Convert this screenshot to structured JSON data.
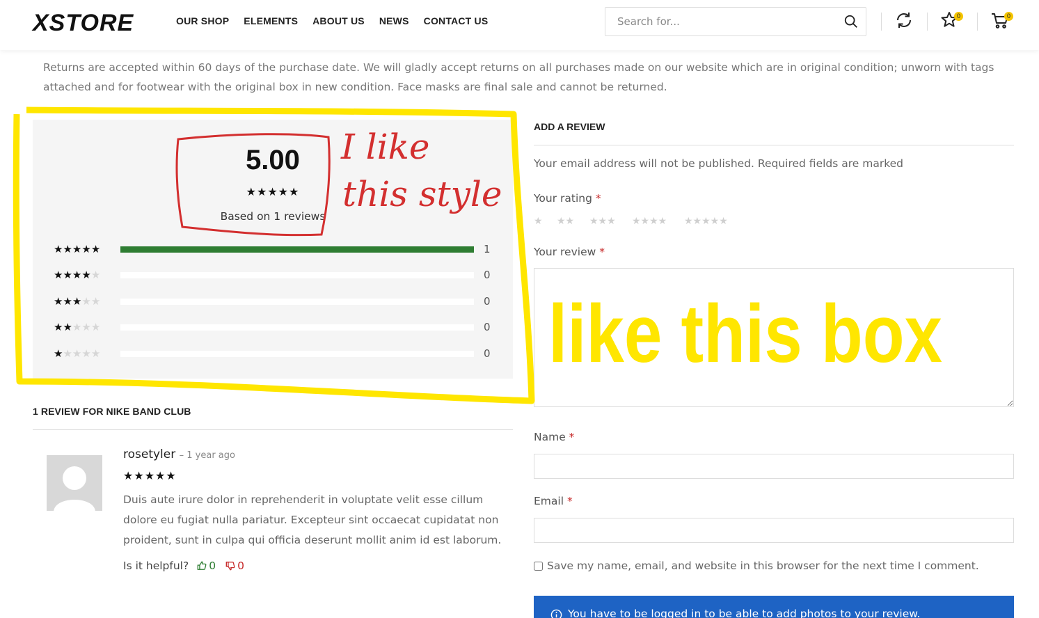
{
  "header": {
    "logo": "XSTORE",
    "nav": [
      "OUR SHOP",
      "ELEMENTS",
      "ABOUT US",
      "NEWS",
      "CONTACT US"
    ],
    "search_placeholder": "Search for...",
    "wishlist_count": "0",
    "cart_count": "0"
  },
  "policy": "Returns are accepted within 60 days of the purchase date. We will gladly accept returns on all purchases made on our website which are in original condition; unworn with tags attached and for footwear with the original box in new condition. Face masks are final sale and cannot be returned.",
  "summary": {
    "score": "5.00",
    "score_stars": "★★★★★",
    "based_on": "Based on 1 reviews",
    "distribution": [
      {
        "stars": 5,
        "count": "1",
        "fraction": 1.0
      },
      {
        "stars": 4,
        "count": "0",
        "fraction": 0
      },
      {
        "stars": 3,
        "count": "0",
        "fraction": 0
      },
      {
        "stars": 2,
        "count": "0",
        "fraction": 0
      },
      {
        "stars": 1,
        "count": "0",
        "fraction": 0
      }
    ]
  },
  "reviews": {
    "title": "1 REVIEW FOR NIKE BAND CLUB",
    "items": [
      {
        "author": "rosetyler",
        "date": "– 1 year ago",
        "stars": "★★★★★",
        "text": "Duis aute irure dolor in reprehenderit in voluptate velit esse cillum dolore eu fugiat nulla pariatur. Excepteur sint occaecat cupidatat non proident, sunt in culpa qui officia deserunt mollit anim id est laborum.",
        "helpful_label": "Is it helpful?",
        "up_count": "0",
        "down_count": "0"
      }
    ]
  },
  "form": {
    "title": "ADD A REVIEW",
    "note": "Your email address will not be published. Required fields are marked",
    "rating_label": "Your rating",
    "rating_options": [
      "★",
      "★★",
      "★★★",
      "★★★★",
      "★★★★★"
    ],
    "review_label": "Your review",
    "name_label": "Name",
    "email_label": "Email",
    "required_mark": "*",
    "save_label": "Save my name, email, and website in this browser for the next time I comment.",
    "login_notice": "You have to be logged in to be able to add photos to your review."
  },
  "annotations": {
    "red_note_line1": "I like",
    "red_note_line2": "this style",
    "yellow_note": "like this box",
    "red_color": "#d32f2f",
    "yellow_color": "#ffe600"
  },
  "colors": {
    "bar_fill": "#2e7d32",
    "accent_yellow": "#f4c400",
    "notice_blue": "#1e63c4",
    "required_red": "#c62828"
  }
}
